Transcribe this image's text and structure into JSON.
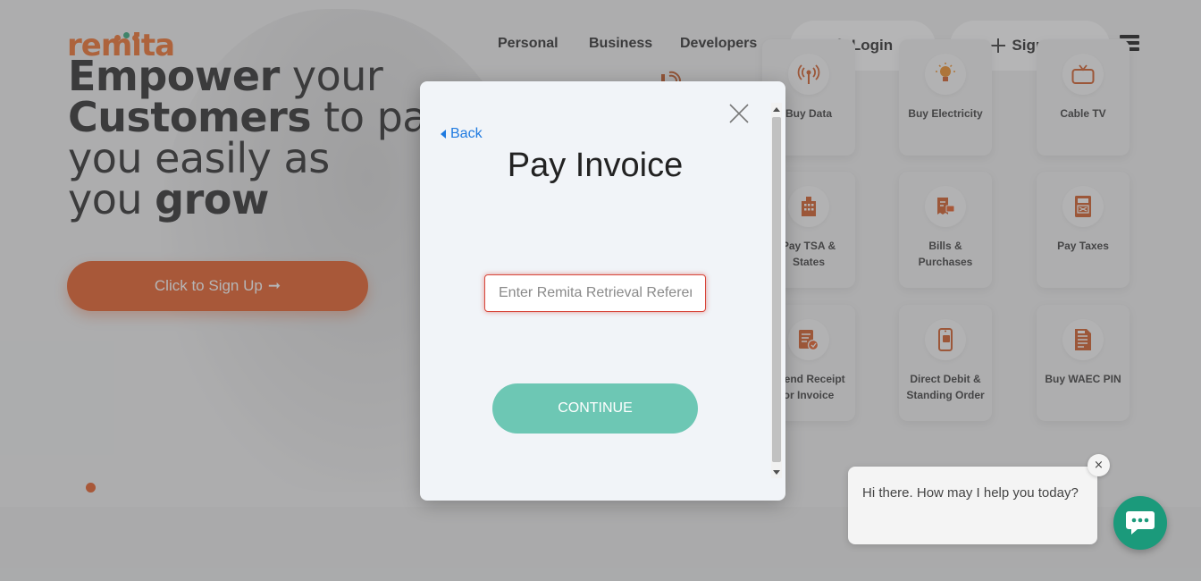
{
  "brand": {
    "logo_text": "remita",
    "logo_dot_colors": [
      "#f06a22",
      "#2aa776",
      "#f06a22"
    ]
  },
  "nav": {
    "links": [
      "Personal",
      "Business",
      "Developers"
    ],
    "login_label": "Login",
    "signup_label": "Sign Up"
  },
  "hero": {
    "line1_bold": "Empower",
    "line1_rest": " your",
    "line2_bold": "Customers",
    "line2_rest": " to pa",
    "line3": "you easily as",
    "line4_rest": "you ",
    "line4_bold": "grow",
    "cta_label": "Click to Sign Up",
    "cta_arrow": "➞"
  },
  "services": [
    {
      "label": "Buy Data",
      "icon": "antenna-icon"
    },
    {
      "label": "Buy Electricity",
      "icon": "bulb-icon"
    },
    {
      "label": "Cable TV",
      "icon": "tv-icon"
    },
    {
      "label": "Pay TSA & States",
      "icon": "building-icon"
    },
    {
      "label": "Bills & Purchases",
      "icon": "receipt-icon"
    },
    {
      "label": "Pay Taxes",
      "icon": "tax-icon"
    },
    {
      "label": "esend Receipt or Invoice",
      "icon": "invoice-icon"
    },
    {
      "label": "Direct Debit & Standing Order",
      "icon": "phone-icon"
    },
    {
      "label": "Buy WAEC PIN",
      "icon": "document-icon"
    }
  ],
  "modal": {
    "back_label": "Back",
    "title": "Pay Invoice",
    "input_placeholder": "Enter Remita Retrieval Reference",
    "input_value": "",
    "continue_label": "CONTINUE"
  },
  "chat": {
    "message": "Hi there. How may I help you today?",
    "close_glyph": "×"
  },
  "colors": {
    "brand_orange": "#e8561c",
    "continue_teal": "#6dc7b4",
    "chat_green": "#1b9a7b",
    "link_blue": "#1f7ae0",
    "input_error": "#d8463a"
  }
}
